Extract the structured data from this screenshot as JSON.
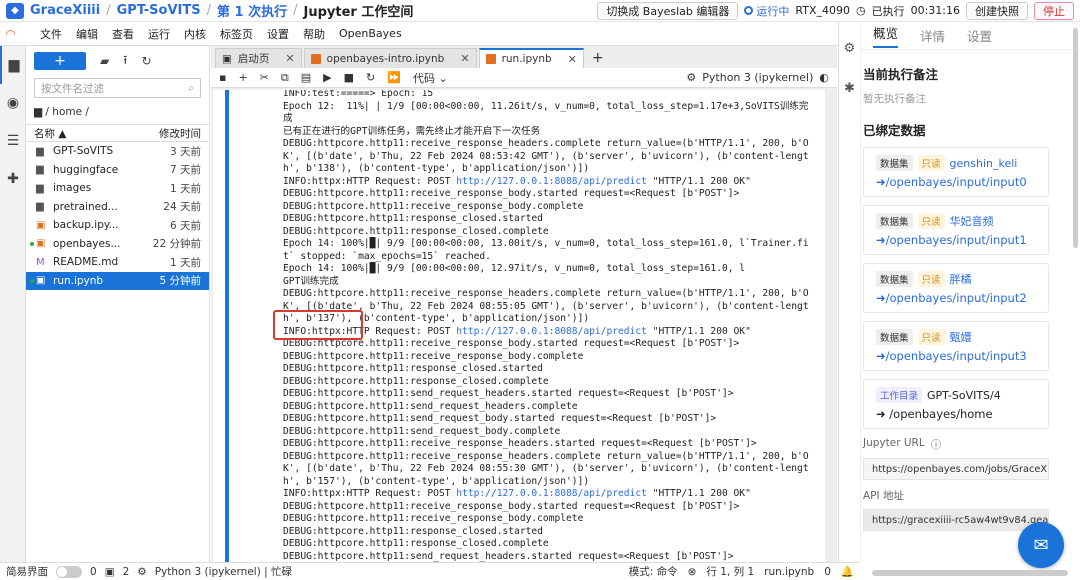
{
  "topbar": {
    "crumbs": [
      "GraceXiiii",
      "GPT-SoVITS",
      "第 1 次执行",
      "Jupyter 工作空间"
    ],
    "separator": "/",
    "switch_label": "切换成 Bayeslab 编辑器",
    "status_label": "运行中",
    "gpu": "RTX_4090",
    "elapsed_label": "已执行",
    "elapsed_time": "00:31:16",
    "snapshot_label": "创建快照",
    "stop_label": "停止"
  },
  "menubar": {
    "items": [
      "文件",
      "编辑",
      "查看",
      "运行",
      "内核",
      "标签页",
      "设置",
      "帮助",
      "OpenBayes"
    ]
  },
  "filepanel": {
    "search_placeholder": "按文件名过滤",
    "path": "/ home /",
    "header_name": "名称",
    "header_modified": "修改时间",
    "files": [
      {
        "icon": "folder-icon",
        "name": "GPT-SoVITS",
        "time": "3 天前",
        "running": false,
        "selected": false
      },
      {
        "icon": "folder-icon",
        "name": "huggingface",
        "time": "7 天前",
        "running": false,
        "selected": false
      },
      {
        "icon": "folder-icon",
        "name": "images",
        "time": "1 天前",
        "running": false,
        "selected": false
      },
      {
        "icon": "folder-icon",
        "name": "pretrained...",
        "time": "24 天前",
        "running": false,
        "selected": false
      },
      {
        "icon": "notebook-icon",
        "name": "backup.ipy...",
        "time": "6 天前",
        "running": false,
        "selected": false
      },
      {
        "icon": "notebook-icon",
        "name": "openbayes...",
        "time": "22 分钟前",
        "running": true,
        "selected": false
      },
      {
        "icon": "markdown-icon",
        "name": "README.md",
        "time": "1 天前",
        "running": false,
        "selected": false
      },
      {
        "icon": "notebook-icon",
        "name": "run.ipynb",
        "time": "5 分钟前",
        "running": true,
        "selected": true
      }
    ]
  },
  "editor": {
    "tabs": [
      {
        "label": "启动页",
        "active": false
      },
      {
        "label": "openbayes-intro.ipynb",
        "active": false
      },
      {
        "label": "run.ipynb",
        "active": true
      }
    ],
    "cell_type": "代码",
    "kernel": "Python 3 (ipykernel)",
    "log_lines": [
      "INFO:test:=====> Epoch: 15",
      "Epoch 12:  11%| | 1/9 [00:00<00:00, 11.26it/s, v_num=0, total_loss_step=1.17e+3,SoVITS训练完",
      "成",
      "已有正在进行的GPT训练任务，需先终止才能开启下一次任务",
      "DEBUG:httpcore.http11:receive_response_headers.complete return_value=(b'HTTP/1.1', 200, b'O",
      "K', [(b'date', b'Thu, 22 Feb 2024 08:53:42 GMT'), (b'server', b'uvicorn'), (b'content-lengt",
      "h', b'138'), (b'content-type', b'application/json')])",
      "INFO:httpx:HTTP Request: POST |http://127.0.0.1:8088/api/predict| \"HTTP/1.1 200 OK\"",
      "DEBUG:httpcore.http11:receive_response_body.started request=<Request [b'POST']>",
      "DEBUG:httpcore.http11:receive_response_body.complete",
      "DEBUG:httpcore.http11:response_closed.started",
      "DEBUG:httpcore.http11:response_closed.complete",
      "Epoch 14: 100%|█| 9/9 [00:00<00:00, 13.00it/s, v_num=0, total_loss_step=161.0, l`Trainer.fi",
      "t` stopped: `max_epochs=15` reached.",
      "Epoch 14: 100%|█| 9/9 [00:00<00:00, 12.97it/s, v_num=0, total_loss_step=161.0, l",
      "GPT训练完成",
      "DEBUG:httpcore.http11:receive_response_headers.complete return_value=(b'HTTP/1.1', 200, b'O",
      "K', [(b'date', b'Thu, 22 Feb 2024 08:55:05 GMT'), (b'server', b'uvicorn'), (b'content-lengt",
      "h', b'137'), (b'content-type', b'application/json')])",
      "INFO:httpx:HTTP Request: POST |http://127.0.0.1:8088/api/predict| \"HTTP/1.1 200 OK\"",
      "DEBUG:httpcore.http11:receive_response_body.started request=<Request [b'POST']>",
      "DEBUG:httpcore.http11:receive_response_body.complete",
      "DEBUG:httpcore.http11:response_closed.started",
      "DEBUG:httpcore.http11:response_closed.complete",
      "DEBUG:httpcore.http11:send_request_headers.started request=<Request [b'POST']>",
      "DEBUG:httpcore.http11:send_request_headers.complete",
      "DEBUG:httpcore.http11:send_request_body.started request=<Request [b'POST']>",
      "DEBUG:httpcore.http11:send_request_body.complete",
      "DEBUG:httpcore.http11:receive_response_headers.started request=<Request [b'POST']>",
      "DEBUG:httpcore.http11:receive_response_headers.complete return_value=(b'HTTP/1.1', 200, b'O",
      "K', [(b'date', b'Thu, 22 Feb 2024 08:55:30 GMT'), (b'server', b'uvicorn'), (b'content-lengt",
      "h', b'157'), (b'content-type', b'application/json')])",
      "INFO:httpx:HTTP Request: POST |http://127.0.0.1:8088/api/predict| \"HTTP/1.1 200 OK\"",
      "DEBUG:httpcore.http11:receive_response_body.started request=<Request [b'POST']>",
      "DEBUG:httpcore.http11:receive_response_body.complete",
      "DEBUG:httpcore.http11:response_closed.started",
      "DEBUG:httpcore.http11:response_closed.complete",
      "DEBUG:httpcore.http11:send_request_headers.started request=<Request [b'POST']>"
    ]
  },
  "rightpanel": {
    "tabs": [
      "概览",
      "详情",
      "设置"
    ],
    "notes_title": "当前执行备注",
    "notes_empty": "暂无执行备注",
    "bound_title": "已绑定数据",
    "bindings": [
      {
        "type": "数据集",
        "mode": "只读",
        "name": "genshin_keli",
        "path": "/openbayes/input/input0"
      },
      {
        "type": "数据集",
        "mode": "只读",
        "name": "华妃音频",
        "path": "/openbayes/input/input1"
      },
      {
        "type": "数据集",
        "mode": "只读",
        "name": "胖橘",
        "path": "/openbayes/input/input2"
      },
      {
        "type": "数据集",
        "mode": "只读",
        "name": "甄嬛",
        "path": "/openbayes/input/input3"
      }
    ],
    "workdir": {
      "type": "工作目录",
      "name": "GPT-SoVITS/4",
      "path": "/openbayes/home"
    },
    "jupyter_url_label": "Jupyter URL",
    "jupyter_url": "https://openbayes.com/jobs/GraceX",
    "api_label": "API 地址",
    "api_url": "https://gracexiiii-rc5aw4wt9v84.gea"
  },
  "statusbar": {
    "simple_label": "简易界面",
    "count_a": "0",
    "count_b": "2",
    "kernel_status": "Python 3 (ipykernel) | 忙碌",
    "mode": "模式: 命令",
    "position": "行 1, 列 1",
    "file": "run.ipynb",
    "notifications": "0"
  },
  "colors": {
    "accent": "#1a73d9",
    "highlight": "#d53a2a",
    "brand_orange": "#e07020"
  }
}
